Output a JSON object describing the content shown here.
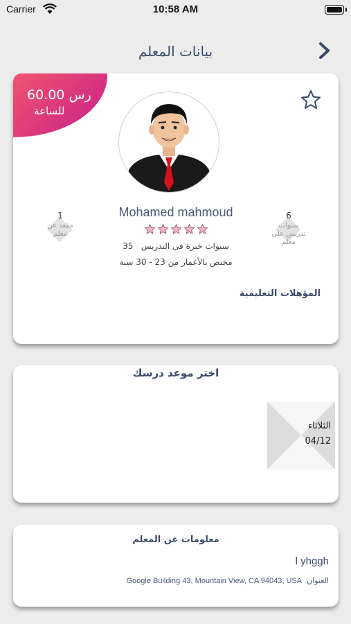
{
  "status_bar": {
    "carrier": "Carrier",
    "time": "10:58 AM"
  },
  "nav": {
    "title": "بيانات المعلم",
    "back_icon": "chevron-right-icon"
  },
  "teacher": {
    "price": "60.00 رس",
    "price_unit": "للساعة",
    "name": "Mohamed mahmoud",
    "rating": 0,
    "rating_max": 5,
    "experience_years": "35",
    "experience_text": "سنوات خبرة فى التدريس",
    "age_range": "مختص بالأعمار من 23 - 30 سنة",
    "qualifications_label": "المؤهلات التعليمية",
    "stat_left": {
      "number": "1",
      "label": "مقعد عن معلم"
    },
    "stat_right": {
      "number": "6",
      "label": "سنوات تدريس على معلم"
    }
  },
  "schedule": {
    "title": "اختر موعد درسك",
    "day_label": "الثلاثاء",
    "date_label": "04/12"
  },
  "info": {
    "title": "معلومات عن المعلم",
    "bio": "l yhggh",
    "address_label": "العنوان",
    "address": "Google Building 43, Mountain View, CA 94043, USA"
  },
  "colors": {
    "accent_start": "#f0546e",
    "accent_end": "#c81e8a",
    "title_text": "#3c4a69",
    "star_pink": "#f0b6c6"
  }
}
